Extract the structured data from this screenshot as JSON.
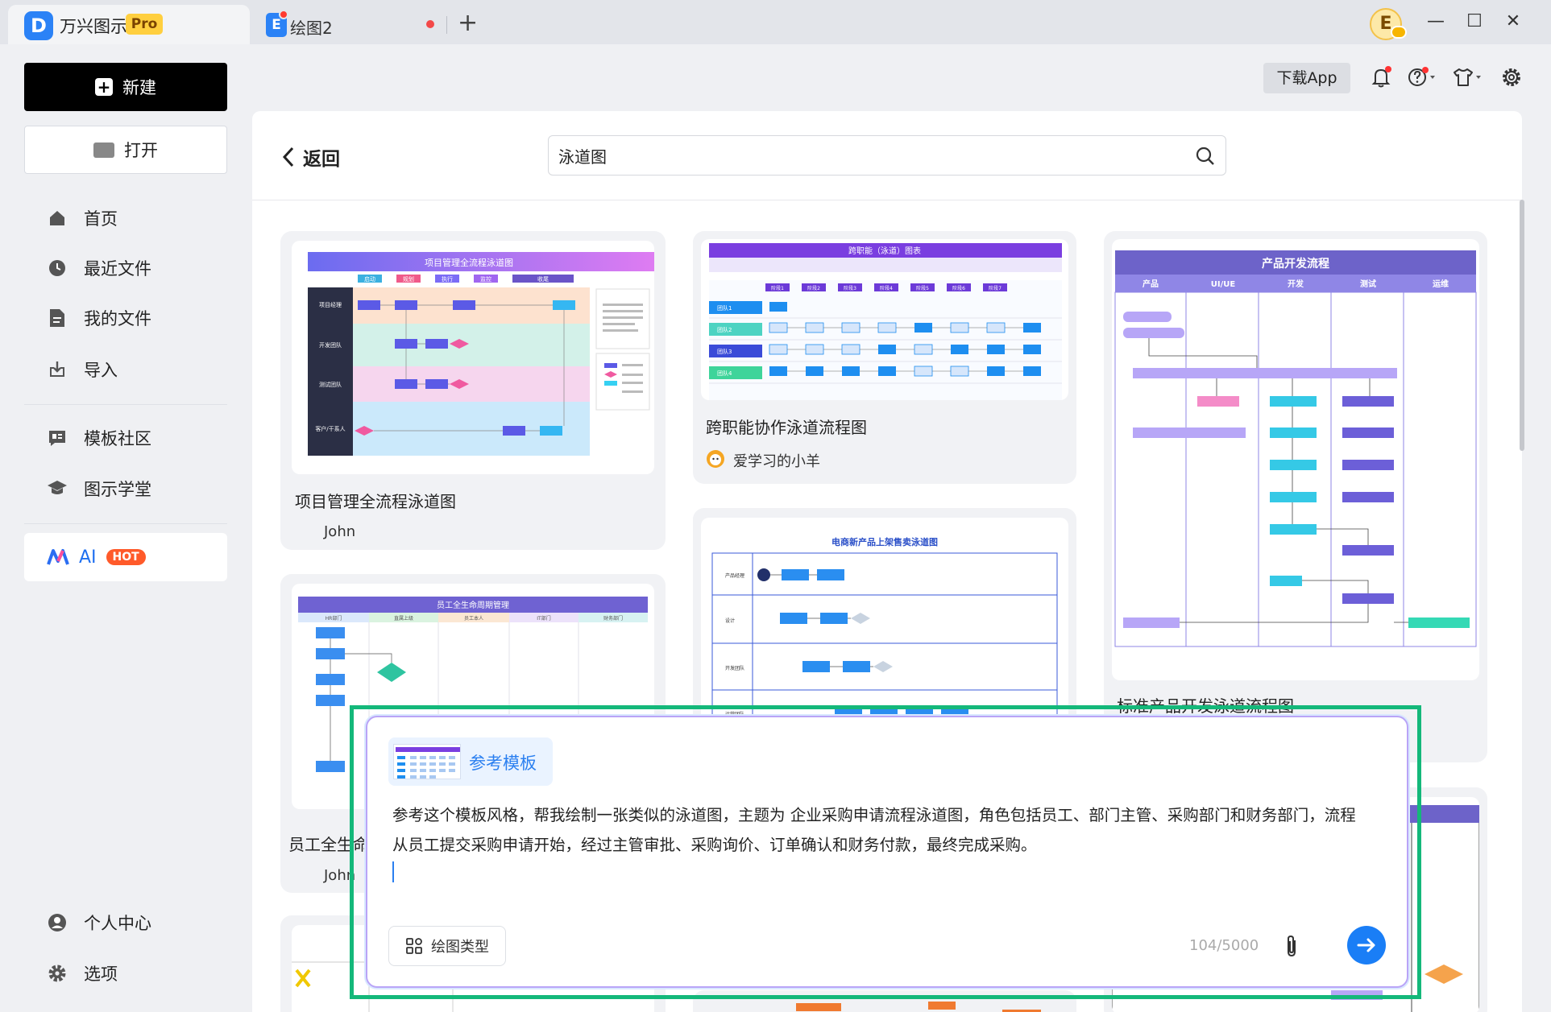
{
  "titlebar": {
    "app_name": "万兴图示",
    "pro_badge": "Pro",
    "tab2_label": "绘图2",
    "add_tab": "+",
    "user_initial": "E",
    "minimize": "—",
    "maximize": "☐",
    "close": "✕"
  },
  "sidebar": {
    "new_label": "新建",
    "open_label": "打开",
    "items": [
      {
        "label": "首页",
        "icon": "home-icon"
      },
      {
        "label": "最近文件",
        "icon": "clock-icon"
      },
      {
        "label": "我的文件",
        "icon": "file-icon"
      },
      {
        "label": "导入",
        "icon": "import-icon"
      },
      {
        "label": "模板社区",
        "icon": "template-community-icon"
      },
      {
        "label": "图示学堂",
        "icon": "graduation-cap-icon"
      }
    ],
    "ai_label": "AI",
    "hot_badge": "HOT",
    "bottom_items": [
      {
        "label": "个人中心",
        "icon": "user-icon"
      },
      {
        "label": "选项",
        "icon": "gear-icon"
      }
    ]
  },
  "topbar": {
    "download_app": "下载App"
  },
  "main": {
    "back_label": "返回",
    "search_value": "泳道图",
    "cards": [
      {
        "title": "项目管理全流程泳道图",
        "author": "John",
        "thumb_title": "项目管理全流程泳道图",
        "phases": [
          "启动",
          "规划",
          "执行",
          "监控",
          "收尾"
        ],
        "lanes": [
          "项目经理",
          "开发团队",
          "测试团队",
          "客户/干系人"
        ]
      },
      {
        "title": "跨职能协作泳道流程图",
        "author": "爱学习的小羊",
        "thumb_title": "跨职能（泳道）图表",
        "phases": [
          "阶段1",
          "阶段2",
          "阶段3",
          "阶段4",
          "阶段5",
          "阶段6",
          "阶段7"
        ],
        "lanes": [
          "团队1",
          "团队2",
          "团队3",
          "团队4"
        ]
      },
      {
        "title": "标准产品开发泳道流程图",
        "thumb_title": "产品开发流程",
        "columns": [
          "产品",
          "UI/UE",
          "开发",
          "测试",
          "运维"
        ]
      },
      {
        "title": "员工全生命周期管理",
        "author": "John",
        "thumb_title": "员工全生命周期管理",
        "columns": [
          "HR部门",
          "直属上级",
          "员工本人",
          "IT部门",
          "财务部门"
        ]
      },
      {
        "thumb_title": "电商新产品上架售卖泳道图",
        "lanes": [
          "产品经理",
          "设计",
          "开发团队",
          "运营团队"
        ]
      }
    ]
  },
  "ai_dialog": {
    "ref_label": "参考模板",
    "prompt": "参考这个模板风格，帮我绘制一张类似的泳道图，主题为 企业采购申请流程泳道图，角色包括员工、部门主管、采购部门和财务部门，流程从员工提交采购申请开始，经过主管审批、采购询价、订单确认和财务付款，最终完成采购。",
    "draw_type_label": "绘图类型",
    "char_count": "104/5000"
  },
  "colors": {
    "accent": "#1a7ef6",
    "frame_highlight": "#14b87a",
    "pro_badge": "#ffcf3f",
    "hot_badge": "#ff5a2a"
  }
}
